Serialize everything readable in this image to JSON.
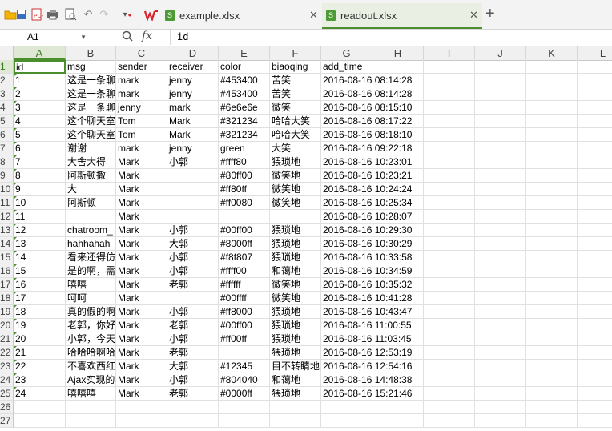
{
  "toolbar": {
    "icons": [
      "open-folder-icon",
      "save-icon",
      "export-pdf-icon",
      "print-icon",
      "print-preview-icon",
      "undo-icon",
      "redo-icon",
      "customize-dropdown-icon"
    ],
    "tabs": [
      {
        "label": "example.xlsx",
        "active": false
      },
      {
        "label": "readout.xlsx",
        "active": true
      }
    ],
    "new_tab_glyph": "+"
  },
  "formula_bar": {
    "cell_ref": "A1",
    "fx": "fx",
    "value": "id"
  },
  "columns": [
    "A",
    "B",
    "C",
    "D",
    "E",
    "F",
    "G",
    "H",
    "I",
    "J",
    "K",
    "L"
  ],
  "sheet": {
    "row_numbers": [
      "1",
      "2",
      "3",
      "4",
      "5",
      "6",
      "7",
      "8",
      "9",
      "10",
      "11",
      "12",
      "13",
      "14",
      "15",
      "16",
      "17",
      "18",
      "19",
      "20",
      "21",
      "22",
      "23",
      "24",
      "25",
      "26",
      "27"
    ],
    "rows": [
      [
        "id",
        "msg",
        "sender",
        "receiver",
        "color",
        "biaoqing",
        "add_time"
      ],
      [
        "1",
        "这是一条聊",
        "mark",
        "jenny",
        "#453400",
        "苦笑",
        "2016-08-16 08:14:28"
      ],
      [
        "2",
        "这是一条聊",
        "mark",
        "jenny",
        "#453400",
        "苦笑",
        "2016-08-16 08:14:28"
      ],
      [
        "3",
        "这是一条聊",
        "jenny",
        "mark",
        "#6e6e6e",
        "微笑",
        "2016-08-16 08:15:10"
      ],
      [
        "4",
        "这个聊天室",
        "Tom",
        "Mark",
        "#321234",
        "哈哈大笑",
        "2016-08-16 08:17:22"
      ],
      [
        "5",
        "这个聊天室",
        "Tom",
        "Mark",
        "#321234",
        "哈哈大笑",
        "2016-08-16 08:18:10"
      ],
      [
        "6",
        "谢谢",
        "mark",
        "jenny",
        "green",
        "大笑",
        "2016-08-16 09:22:18"
      ],
      [
        "7",
        "大舍大得",
        "Mark",
        "小郭",
        "#ffff80",
        "猥琐地",
        "2016-08-16 10:23:01"
      ],
      [
        "8",
        "阿斯顿撒",
        "Mark",
        "",
        "#80ff00",
        "微笑地",
        "2016-08-16 10:23:21"
      ],
      [
        "9",
        "大",
        "Mark",
        "",
        "#ff80ff",
        "微笑地",
        "2016-08-16 10:24:24"
      ],
      [
        "10",
        "阿斯顿",
        "Mark",
        "",
        "#ff0080",
        "微笑地",
        "2016-08-16 10:25:34"
      ],
      [
        "11",
        "",
        "Mark",
        "",
        "",
        "",
        "2016-08-16 10:28:07"
      ],
      [
        "12",
        "chatroom_",
        "Mark",
        "小郭",
        "#00ff00",
        "猥琐地",
        "2016-08-16 10:29:30"
      ],
      [
        "13",
        "hahhahah",
        "Mark",
        "大郭",
        "#8000ff",
        "猥琐地",
        "2016-08-16 10:30:29"
      ],
      [
        "14",
        "看来还得仿",
        "Mark",
        "小郭",
        "#f8f807",
        "猥琐地",
        "2016-08-16 10:33:58"
      ],
      [
        "15",
        "是的啊，需",
        "Mark",
        "小郭",
        "#ffff00",
        "和蔼地",
        "2016-08-16 10:34:59"
      ],
      [
        "16",
        "嘻嘻",
        "Mark",
        "老郭",
        "#ffffff",
        "微笑地",
        "2016-08-16 10:35:32"
      ],
      [
        "17",
        "呵呵",
        "Mark",
        "",
        "#00ffff",
        "微笑地",
        "2016-08-16 10:41:28"
      ],
      [
        "18",
        "真的假的啊",
        "Mark",
        "小郭",
        "#ff8000",
        "猥琐地",
        "2016-08-16 10:43:47"
      ],
      [
        "19",
        "老郭，你好",
        "Mark",
        "老郭",
        "#00ff00",
        "猥琐地",
        "2016-08-16 11:00:55"
      ],
      [
        "20",
        "小郭，今天",
        "Mark",
        "小郭",
        "#ff00ff",
        "猥琐地",
        "2016-08-16 11:03:45"
      ],
      [
        "21",
        "哈哈哈啊哈",
        "Mark",
        "老郭",
        "",
        "猥琐地",
        "2016-08-16 12:53:19"
      ],
      [
        "22",
        "不喜欢西红",
        "Mark",
        "大郭",
        "#12345",
        "目不转睛地",
        "2016-08-16 12:54:16"
      ],
      [
        "23",
        "Ajax实现的",
        "Mark",
        "小郭",
        "#804040",
        "和蔼地",
        "2016-08-16 14:48:38"
      ],
      [
        "24",
        "嘻嘻嘻",
        "Mark",
        "老郭",
        "#0000ff",
        "猥琐地",
        "2016-08-16 15:21:46"
      ]
    ]
  },
  "colors": {
    "accent_green": "#4b8f2d",
    "wps_logo_red": "#d8232a"
  }
}
